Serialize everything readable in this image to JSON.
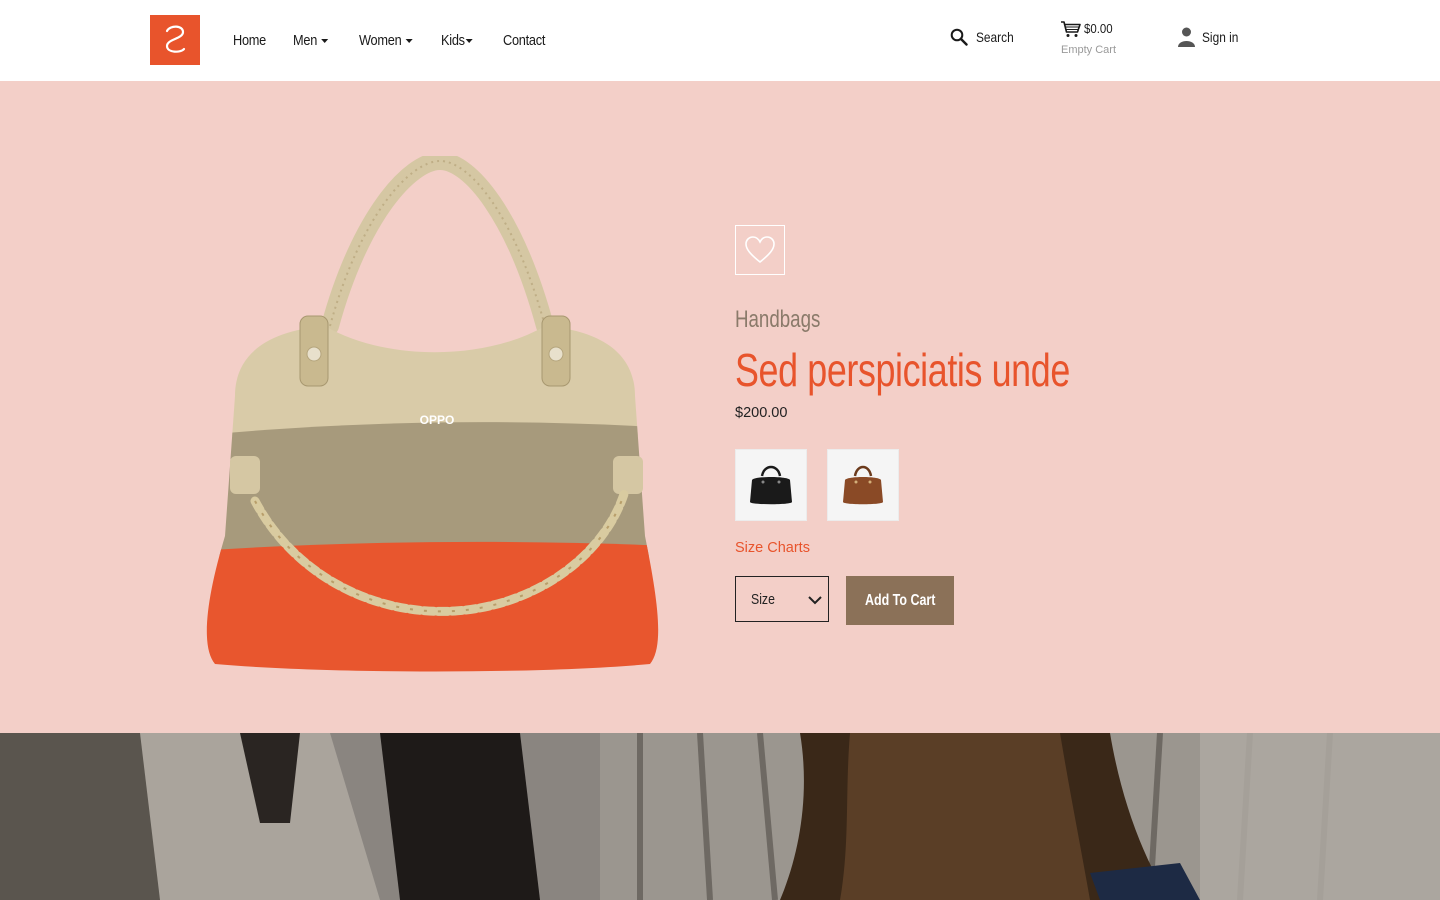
{
  "brand": {
    "logo_name": "site-logo",
    "accent": "#e8542c"
  },
  "nav": {
    "items": [
      {
        "label": "Home",
        "has_dropdown": false
      },
      {
        "label": "Men",
        "has_dropdown": true
      },
      {
        "label": "Women",
        "has_dropdown": true
      },
      {
        "label": "Kids",
        "has_dropdown": true
      },
      {
        "label": "Contact",
        "has_dropdown": false
      }
    ]
  },
  "header_actions": {
    "search_label": "Search",
    "search_icon": "search-icon",
    "cart_total": "$0.00",
    "cart_status": "Empty Cart",
    "cart_icon": "cart-icon",
    "signin_label": "Sign in",
    "user_icon": "user-icon"
  },
  "product": {
    "category": "Handbags",
    "title": "Sed perspiciatis unde",
    "price": "$200.00",
    "wishlist_icon": "heart-icon",
    "variants": [
      {
        "name": "black-handbag-thumbnail",
        "color": "#1a1a1a"
      },
      {
        "name": "brown-handbag-thumbnail",
        "color": "#8a4a26"
      }
    ],
    "size_charts_label": "Size Charts",
    "size_select_value": "Size",
    "add_to_cart_label": "Add To Cart"
  },
  "colors": {
    "hero_background": "#f3cfc8",
    "accent": "#e8542c",
    "button": "#8b7158",
    "category_text": "#8a7a6a"
  }
}
